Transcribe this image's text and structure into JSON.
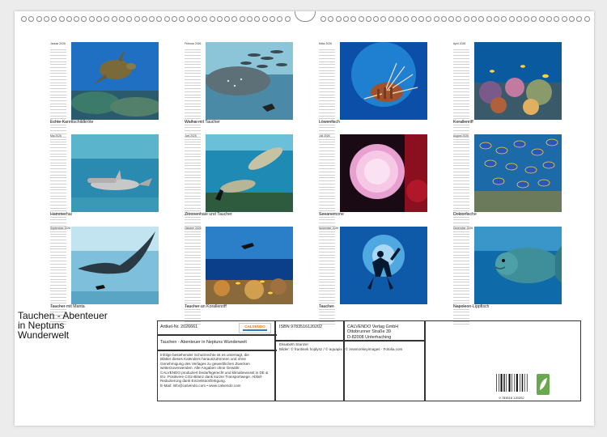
{
  "months": [
    {
      "head": "Januar 2026",
      "caption": "Echte Karettschildkröte",
      "scene": "turtle"
    },
    {
      "head": "Februar 2026",
      "caption": "Walhai mit Taucher",
      "scene": "whaleshark"
    },
    {
      "head": "März 2026",
      "caption": "Löwenfisch",
      "scene": "lionfish"
    },
    {
      "head": "April 2026",
      "caption": "Korallenriff",
      "scene": "reef"
    },
    {
      "head": "Mai 2026",
      "caption": "Hammerhai",
      "scene": "hammer"
    },
    {
      "head": "Juni 2026",
      "caption": "Zitronenhaie und Taucher",
      "scene": "lemon"
    },
    {
      "head": "Juli 2026",
      "caption": "Seeanemone",
      "scene": "anemone"
    },
    {
      "head": "August 2026",
      "caption": "Doktorfische",
      "scene": "surgeon"
    },
    {
      "head": "September 2026",
      "caption": "Taucher mit Manta",
      "scene": "manta"
    },
    {
      "head": "Oktober 2026",
      "caption": "Taucher an Korallenriff",
      "scene": "diverreef"
    },
    {
      "head": "November 2026",
      "caption": "Taucher",
      "scene": "diver"
    },
    {
      "head": "Dezember 2026",
      "caption": "Napoleon-Lippfisch",
      "scene": "napoleon"
    }
  ],
  "title": {
    "line1": "Tauchen - Abenteuer",
    "line2": "in Neptuns",
    "line3": "Wunderwelt"
  },
  "info": {
    "article": "Artikel-Nr. 2026661",
    "product_title": "Tauchen - Abenteuer in Neptuns Wunderwelt",
    "isbn": "ISBN 9783516120202",
    "publisher_name": "CALVENDO Verlag GmbH",
    "publisher_street": "Ottobrunner Straße 39",
    "publisher_city": "D-82008 Unterhaching",
    "logo": "CALVENDO",
    "author": "Elisabeth Stanzer",
    "credits": "Bilder: © frantisek hojdysz / © aquapix / © zeamonkeyimages - Fotolia.com",
    "legal1": "Infolge bestehender Schutzrechte ist es untersagt, die",
    "legal2": "Blätter dieses Kalenders herauszutrennen und ohne",
    "legal3": "Genehmigung des Verlages zu gewerblichen Zwecken",
    "legal4": "weiterzuverwenden. Alle Angaben ohne Gewähr.",
    "legal5": "CALVENDO produziert bedarfsgerecht und klimabewusst in DE &",
    "legal6": "EU. Positivere CO2-Bilanz dank kurzer Transportwege. Abfall-",
    "legal7": "Reduzierung dank Einzelstückfertigung.",
    "legal8": "E-Mail: info@calvendo.com • www.calvendo.com",
    "barcode_number": "9 783516 120202"
  }
}
